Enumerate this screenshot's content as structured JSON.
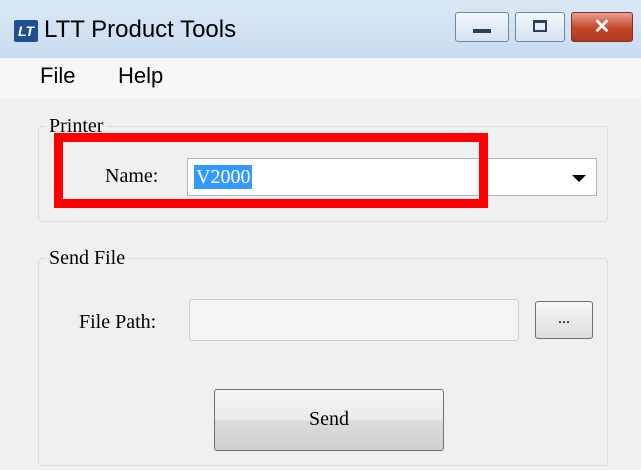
{
  "window": {
    "title": "LTT Product Tools",
    "icon_text": "LT",
    "controls": {
      "minimize": "minimize-icon",
      "maximize": "maximize-icon",
      "close": "✕"
    }
  },
  "menu": {
    "file": "File",
    "help": "Help"
  },
  "printer": {
    "legend": "Printer",
    "name_label": "Name:",
    "selected_value": "V2000"
  },
  "send_file": {
    "legend": "Send File",
    "path_label": "File Path:",
    "path_value": "",
    "browse_label": "...",
    "send_label": "Send"
  },
  "colors": {
    "highlight": "#ff0000",
    "selection": "#3399ff"
  }
}
